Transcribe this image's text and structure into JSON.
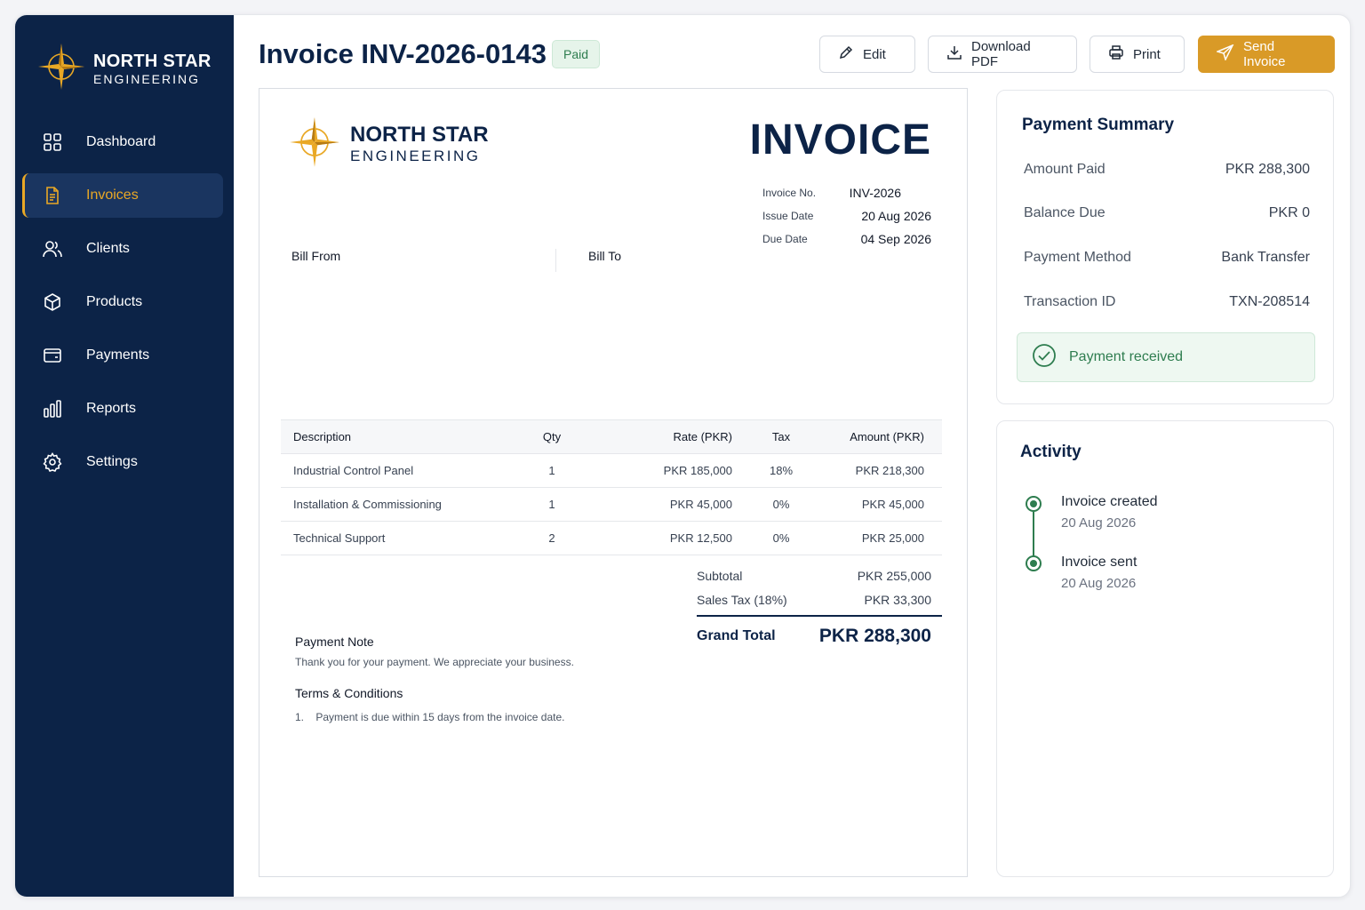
{
  "brand": {
    "line1": "NORTH STAR",
    "line2": "ENGINEERING"
  },
  "sidebar": {
    "items": [
      {
        "label": "Dashboard",
        "icon": "grid-icon"
      },
      {
        "label": "Invoices",
        "icon": "document-icon"
      },
      {
        "label": "Clients",
        "icon": "users-icon"
      },
      {
        "label": "Products",
        "icon": "box-icon"
      },
      {
        "label": "Payments",
        "icon": "wallet-icon"
      },
      {
        "label": "Reports",
        "icon": "bar-chart-icon"
      },
      {
        "label": "Settings",
        "icon": "gear-icon"
      }
    ],
    "active_index": 1
  },
  "header": {
    "title": "Invoice INV-2026-0143",
    "status_badge": "Paid",
    "buttons": {
      "edit": "Edit",
      "download": "Download PDF",
      "print": "Print",
      "send": "Send Invoice"
    }
  },
  "invoice": {
    "heading": "INVOICE",
    "meta": [
      {
        "label": "Invoice No.",
        "value": "INV-2026"
      },
      {
        "label": "Issue Date",
        "value": "20 Aug 2026"
      },
      {
        "label": "Due Date",
        "value": "04 Sep 2026"
      }
    ],
    "bill_from": "Bill From",
    "bill_to": "Bill To",
    "table": {
      "headers": [
        "Description",
        "Qty",
        "Rate (PKR)",
        "Tax",
        "Amount (PKR)"
      ],
      "rows": [
        [
          "Industrial Control Panel",
          "1",
          "PKR 185,000",
          "18%",
          "PKR 218,300"
        ],
        [
          "Installation & Commissioning",
          "1",
          "PKR 45,000",
          "0%",
          "PKR 45,000"
        ],
        [
          "Technical Support",
          "2",
          "PKR 12,500",
          "0%",
          "PKR 25,000"
        ]
      ]
    },
    "totals": {
      "subtotal_label": "Subtotal",
      "subtotal": "PKR 255,000",
      "tax_label": "Sales Tax (18%)",
      "tax": "PKR 33,300",
      "grand_label": "Grand Total",
      "grand": "PKR 288,300"
    },
    "payment_note_title": "Payment Note",
    "payment_note": "Thank you for your payment. We appreciate your business.",
    "terms_title": "Terms & Conditions",
    "terms": [
      "Payment is due within 15 days from the invoice date."
    ]
  },
  "payment_summary": {
    "title": "Payment Summary",
    "rows": [
      {
        "label": "Amount Paid",
        "value": "PKR 288,300"
      },
      {
        "label": "Balance Due",
        "value": "PKR 0"
      },
      {
        "label": "Payment Method",
        "value": "Bank Transfer"
      },
      {
        "label": "Transaction ID",
        "value": "TXN-208514"
      }
    ],
    "received_text": "Payment received"
  },
  "activity": {
    "title": "Activity",
    "items": [
      {
        "event": "Invoice created",
        "date": "20 Aug 2026"
      },
      {
        "event": "Invoice sent",
        "date": "20 Aug 2026"
      }
    ]
  },
  "colors": {
    "navy": "#0c2347",
    "gold": "#d99a27",
    "green": "#2e7d4f"
  }
}
